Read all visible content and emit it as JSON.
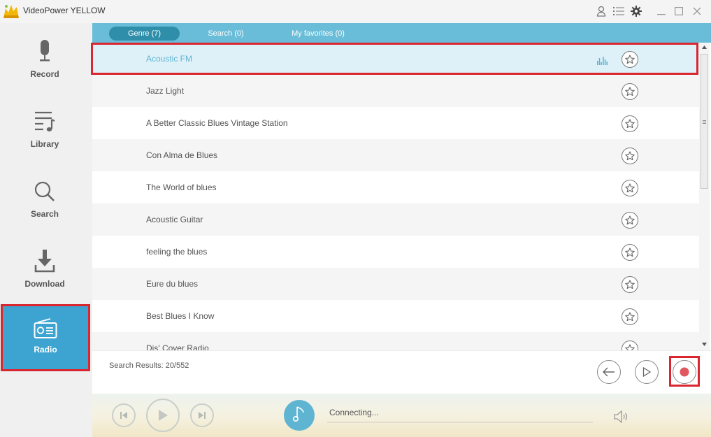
{
  "app": {
    "title": "VideoPower YELLOW"
  },
  "titlebar": {
    "icons": [
      "user-icon",
      "menu-list-icon",
      "gear-icon",
      "minimize-icon",
      "maximize-icon",
      "close-icon"
    ]
  },
  "sidebar": {
    "items": [
      {
        "label": "Record",
        "icon": "microphone-icon",
        "active": false
      },
      {
        "label": "Library",
        "icon": "music-list-icon",
        "active": false
      },
      {
        "label": "Search",
        "icon": "search-icon",
        "active": false
      },
      {
        "label": "Download",
        "icon": "download-icon",
        "active": false
      },
      {
        "label": "Radio",
        "icon": "radio-icon",
        "active": true
      }
    ]
  },
  "tabs": [
    {
      "label": "Genre (7)",
      "active": true
    },
    {
      "label": "Search (0)",
      "active": false
    },
    {
      "label": "My favorites (0)",
      "active": false
    }
  ],
  "stations": [
    {
      "name": "Acoustic FM",
      "selected": true,
      "playing": true
    },
    {
      "name": "Jazz Light"
    },
    {
      "name": "A Better Classic Blues Vintage Station"
    },
    {
      "name": "Con Alma de Blues"
    },
    {
      "name": "The World of blues"
    },
    {
      "name": "Acoustic Guitar"
    },
    {
      "name": "feeling the blues"
    },
    {
      "name": "Eure du blues"
    },
    {
      "name": "Best Blues I Know"
    },
    {
      "name": "Dis' Cover Radio"
    }
  ],
  "results": {
    "text": "Search Results: 20/552"
  },
  "player": {
    "status": "Connecting...",
    "progress": 0.0
  },
  "colors": {
    "accent": "#69bdd8",
    "accent_dark": "#2f8fab",
    "highlight_frame": "#d9262f",
    "record_dot": "#e0575e"
  }
}
